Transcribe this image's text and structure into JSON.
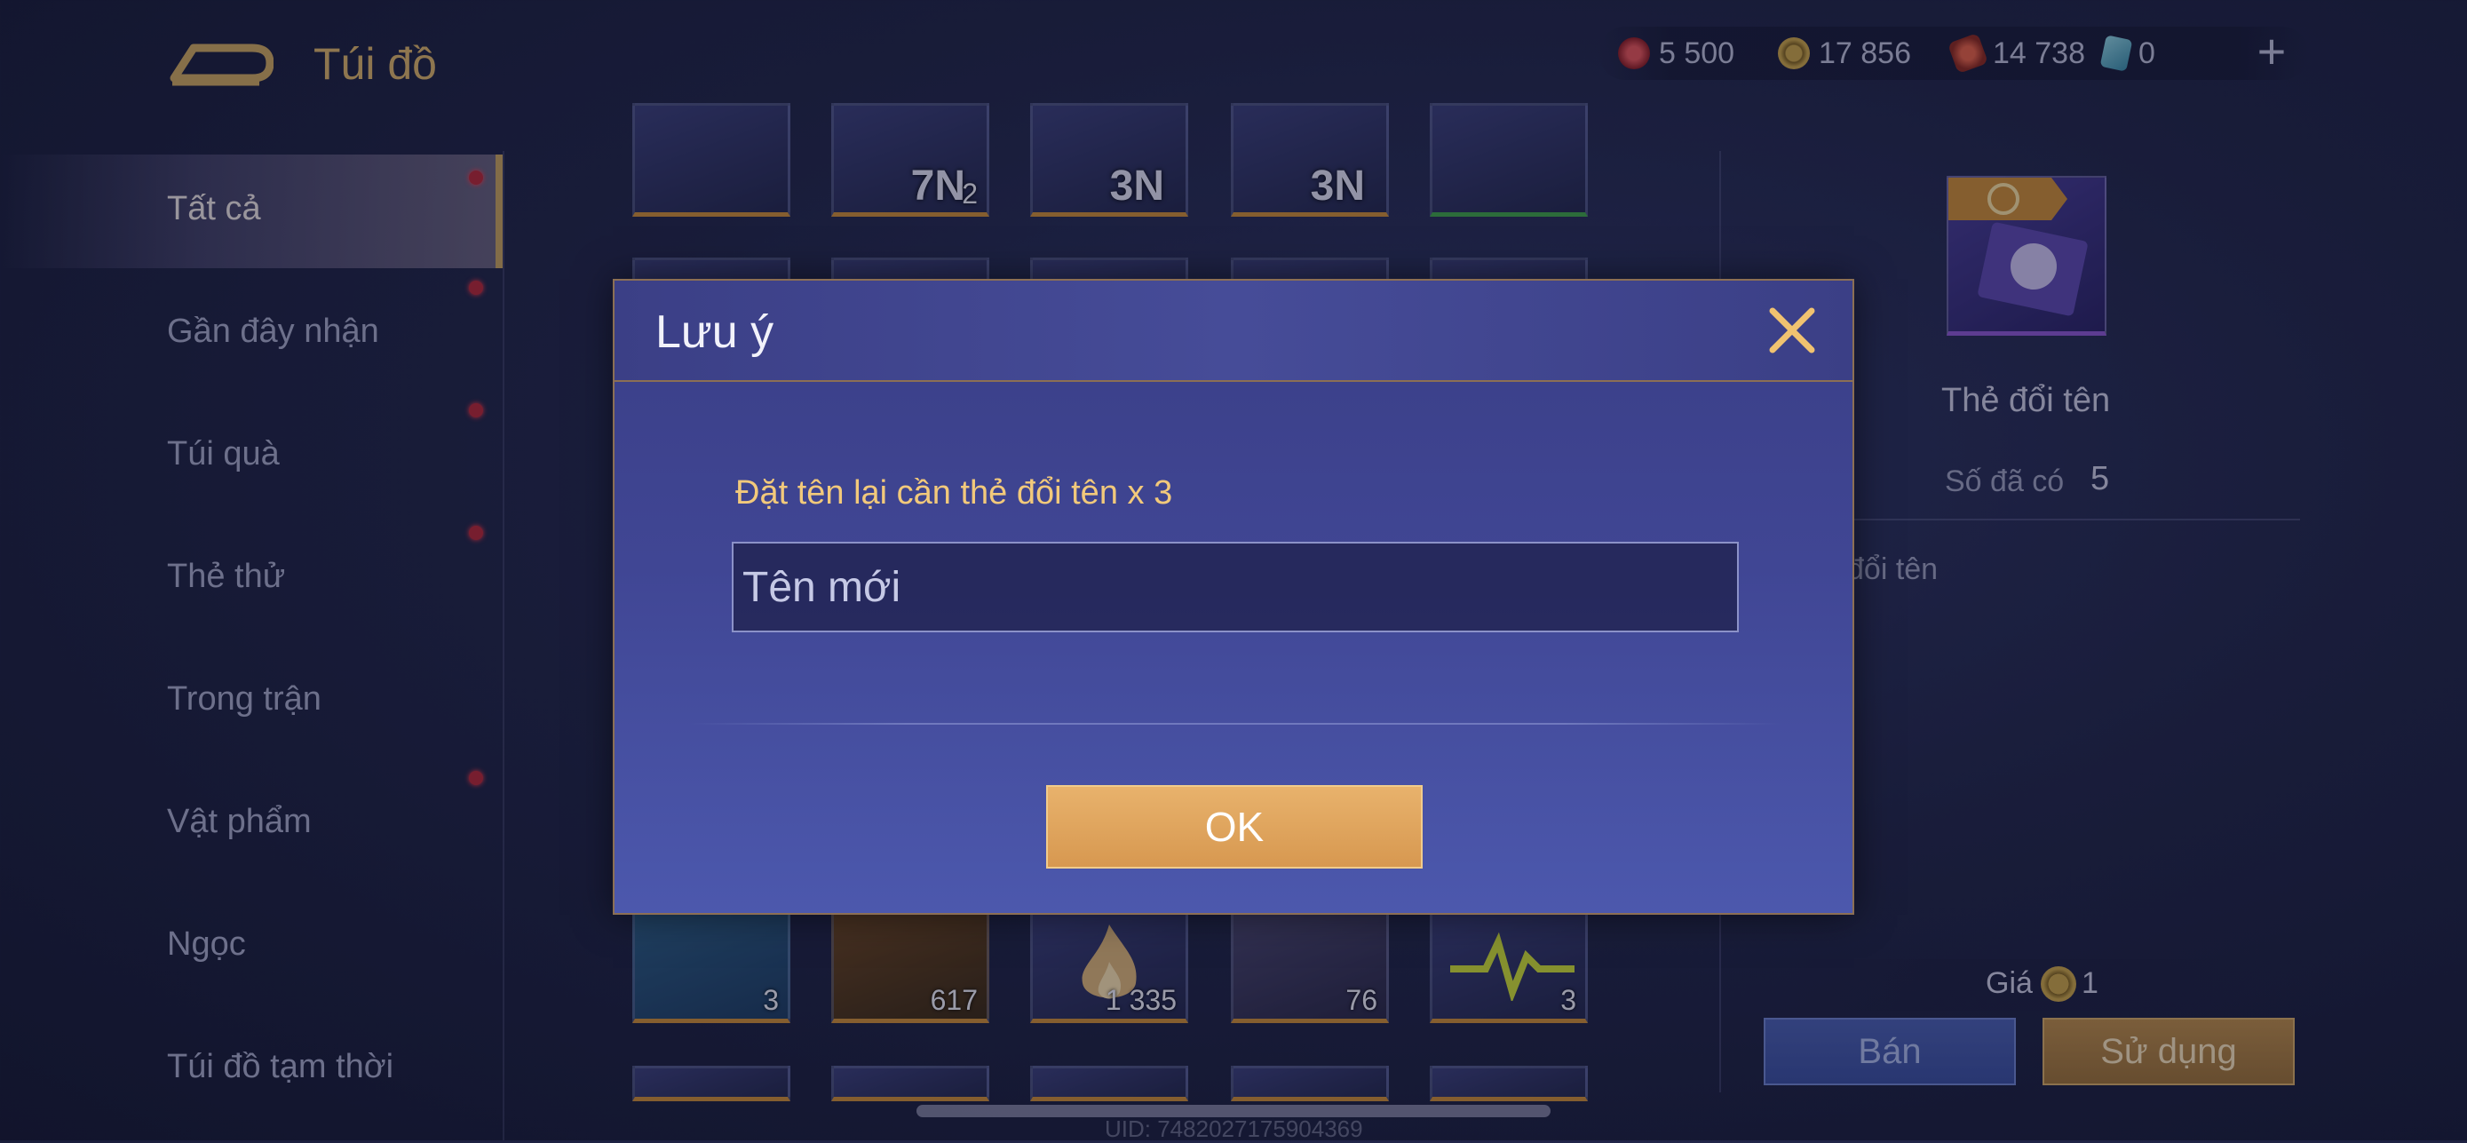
{
  "header": {
    "title": "Túi đồ",
    "currencies": [
      {
        "icon": "red-gem-icon",
        "value": "5 500",
        "color": "#c0383e"
      },
      {
        "icon": "gold-coin-icon",
        "value": "17 856",
        "color": "#c6a24a"
      },
      {
        "icon": "red-voucher-icon",
        "value": "14 738",
        "color": "#c8463a"
      },
      {
        "icon": "blue-card-icon",
        "value": "0",
        "color": "#5fb1c8"
      }
    ]
  },
  "sidebar": {
    "items": [
      {
        "label": "Tất cả",
        "active": true,
        "dot": true
      },
      {
        "label": "Gần đây nhận",
        "active": false,
        "dot": true
      },
      {
        "label": "Túi quà",
        "active": false,
        "dot": true
      },
      {
        "label": "Thẻ thử",
        "active": false,
        "dot": true
      },
      {
        "label": "Trong trận",
        "active": false,
        "dot": false
      },
      {
        "label": "Vật phẩm",
        "active": false,
        "dot": true
      },
      {
        "label": "Ngọc",
        "active": false,
        "dot": false
      },
      {
        "label": "Túi đồ tạm thời",
        "active": false,
        "dot": false
      }
    ]
  },
  "grid": {
    "top_row": [
      "",
      "7N",
      "3N",
      "3N",
      ""
    ],
    "top_row_counts": [
      "",
      "2",
      "",
      "",
      ""
    ],
    "bottom_row_counts": [
      "3",
      "617",
      "1 335",
      "76",
      "3"
    ]
  },
  "detail": {
    "item_name": "Thẻ đổi tên",
    "owned_label": "Số đã có",
    "owned_count": "5",
    "description_fragment": "đổi tên",
    "price_label": "Giá",
    "price_value": "1",
    "sell_label": "Bán",
    "use_label": "Sử dụng"
  },
  "uid": "UID: 7482027175904369",
  "dialog": {
    "title": "Lưu ý",
    "message": "Đặt tên lại cần thẻ đổi tên x 3",
    "input_placeholder": "Tên mới",
    "input_value": "",
    "ok_label": "OK"
  }
}
